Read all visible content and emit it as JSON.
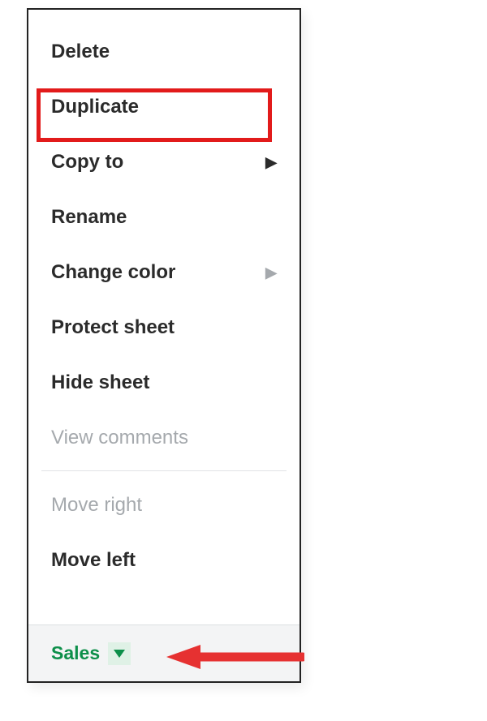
{
  "menu": {
    "items": [
      {
        "label": "Delete",
        "has_submenu": false,
        "disabled": false
      },
      {
        "label": "Duplicate",
        "has_submenu": false,
        "disabled": false,
        "highlighted": true
      },
      {
        "label": "Copy to",
        "has_submenu": true,
        "submenu_dark": true,
        "disabled": false
      },
      {
        "label": "Rename",
        "has_submenu": false,
        "disabled": false
      },
      {
        "label": "Change color",
        "has_submenu": true,
        "submenu_dark": false,
        "disabled": false
      },
      {
        "label": "Protect sheet",
        "has_submenu": false,
        "disabled": false
      },
      {
        "label": "Hide sheet",
        "has_submenu": false,
        "disabled": false
      },
      {
        "label": "View comments",
        "has_submenu": false,
        "disabled": true
      },
      {
        "label": "Move right",
        "has_submenu": false,
        "disabled": true
      },
      {
        "label": "Move left",
        "has_submenu": false,
        "disabled": false
      }
    ]
  },
  "sheet_tab": {
    "label": "Sales"
  },
  "annotation": {
    "highlight_color": "#e21b1b",
    "arrow_color": "#e63131"
  }
}
